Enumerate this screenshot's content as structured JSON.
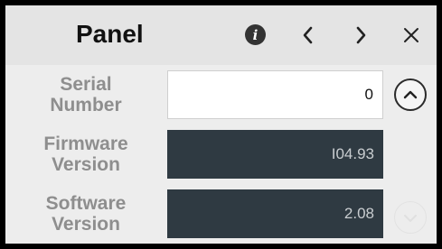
{
  "panel": {
    "title": "Panel",
    "icons": {
      "info": "info-icon",
      "prev": "chevron-left-icon",
      "next": "chevron-right-icon",
      "close": "close-icon"
    }
  },
  "rows": [
    {
      "label_line1": "Serial",
      "label_line2": "Number",
      "value": "0",
      "editable": true
    },
    {
      "label_line1": "Firmware",
      "label_line2": "Version",
      "value": "I04.93",
      "editable": false
    },
    {
      "label_line1": "Software",
      "label_line2": "Version",
      "value": "2.08",
      "editable": false
    }
  ],
  "scroll": {
    "up_icon": "chevron-up-icon",
    "down_icon": "chevron-down-icon",
    "down_enabled": false
  },
  "colors": {
    "header_bg": "#e4e4e4",
    "label_text": "#8e8e8e",
    "readonly_field_bg": "#2f3a42",
    "readonly_field_text": "#c9cdd0"
  }
}
